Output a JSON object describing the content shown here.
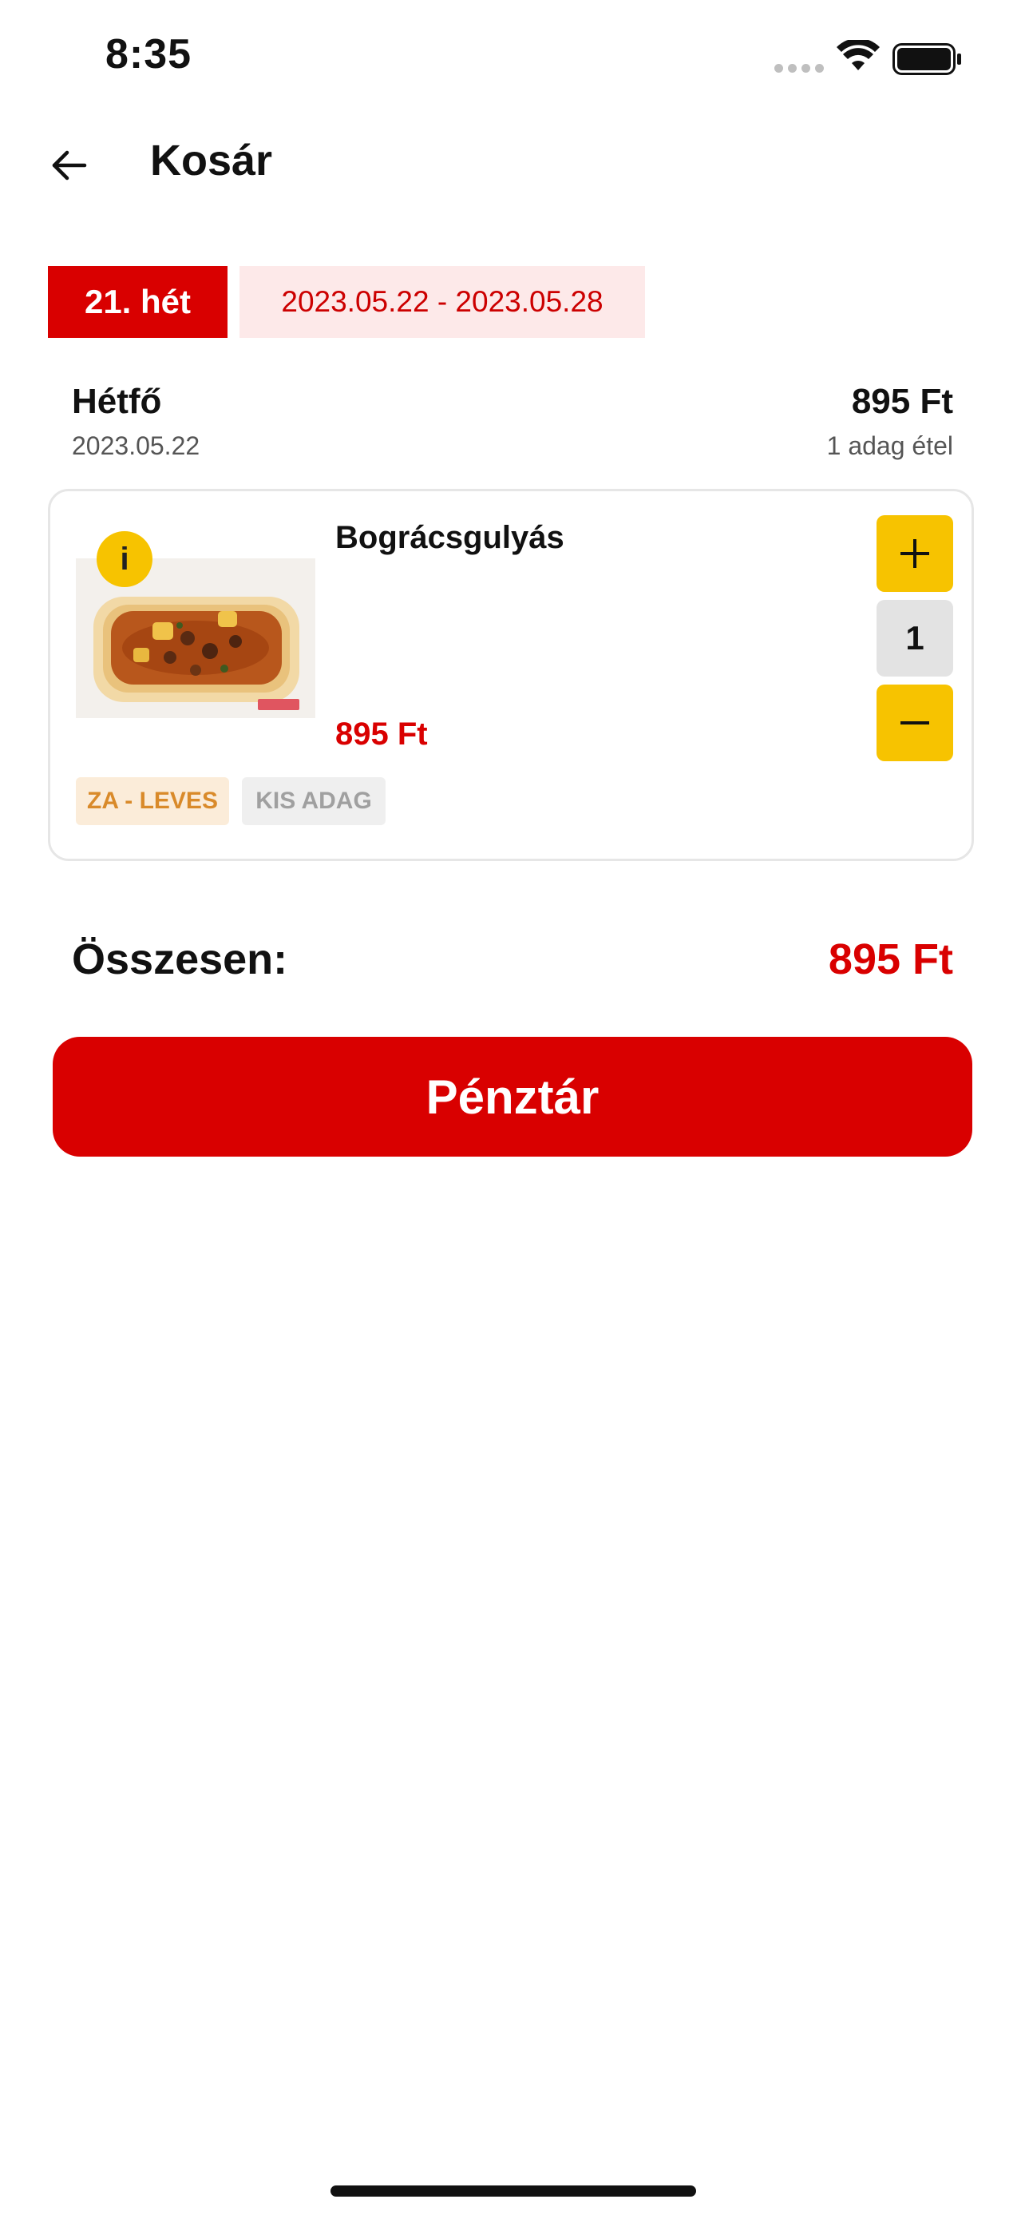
{
  "status_bar": {
    "time": "8:35"
  },
  "header": {
    "back_icon": "arrow-left-icon",
    "title": "Kosár"
  },
  "week": {
    "label": "21. hét",
    "range": "2023.05.22 - 2023.05.28"
  },
  "day": {
    "name": "Hétfő",
    "date": "2023.05.22",
    "price": "895 Ft",
    "count": "1 adag étel"
  },
  "item": {
    "name": "Bográcsgulyás",
    "price": "895 Ft",
    "info_label": "i",
    "quantity": "1",
    "tags": {
      "category": "ZA - LEVES",
      "size": "KIS ADAG"
    }
  },
  "total": {
    "label": "Összesen:",
    "value": "895 Ft"
  },
  "checkout": {
    "label": "Pénztár"
  },
  "colors": {
    "primary_red": "#d90000",
    "accent_yellow": "#f7c300",
    "tag_category_bg": "#fbecd9",
    "tag_category_text": "#d98a2a"
  }
}
